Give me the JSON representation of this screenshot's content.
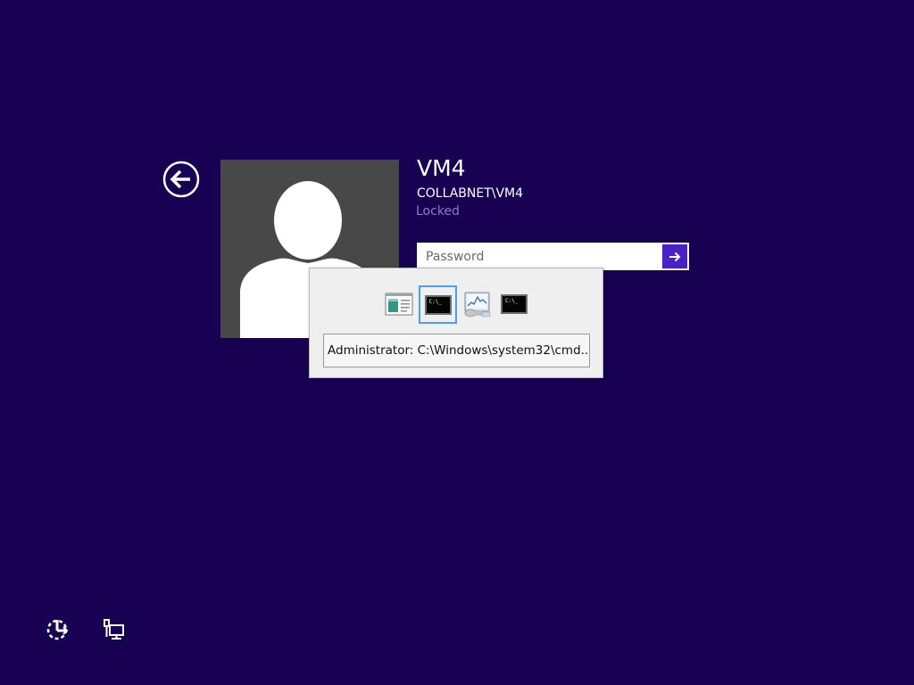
{
  "user": {
    "name": "VM4",
    "domain_account": "COLLABNET\\VM4",
    "status": "Locked"
  },
  "password": {
    "placeholder": "Password",
    "value": ""
  },
  "task_switcher": {
    "apps": [
      {
        "icon": "server-manager-icon",
        "selected": false
      },
      {
        "icon": "command-prompt-icon",
        "selected": true,
        "glyph": "C:\\_"
      },
      {
        "icon": "performance-monitor-icon",
        "selected": false
      },
      {
        "icon": "command-prompt-icon",
        "selected": false,
        "glyph": "C:\\_"
      }
    ],
    "selected_window_title": "Administrator: C:\\Windows\\system32\\cmd...."
  },
  "colors": {
    "background": "#180052",
    "accent": "#4a21c7",
    "status_text": "#8a7ec6",
    "selection_border": "#4a9ff0"
  }
}
